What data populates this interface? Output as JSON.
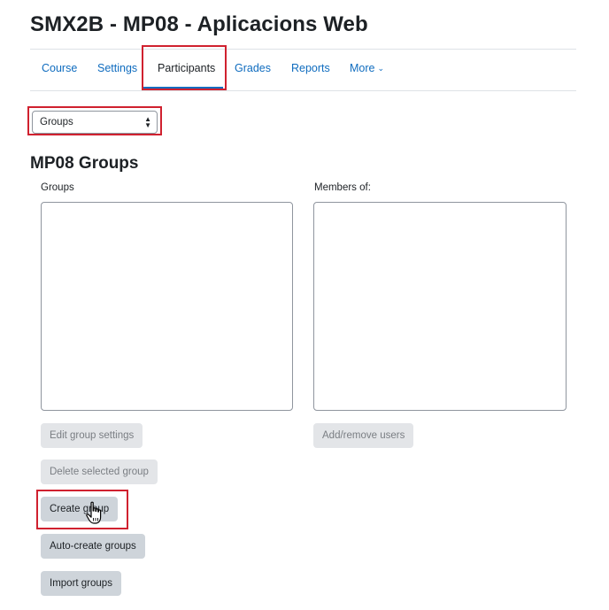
{
  "course": {
    "title": "SMX2B - MP08 - Aplicacions Web"
  },
  "nav": {
    "items": [
      "Course",
      "Settings",
      "Participants",
      "Grades",
      "Reports",
      "More"
    ],
    "active": "Participants",
    "more_icon": "chevron-down-icon"
  },
  "page_select": {
    "value": "Groups",
    "icon": "sort-arrows-icon"
  },
  "groups_page": {
    "title": "MP08 Groups",
    "groups_label": "Groups",
    "members_label": "Members of:",
    "groups_list": [],
    "members_list": []
  },
  "buttons": {
    "edit_group_settings": "Edit group settings",
    "delete_selected_group": "Delete selected group",
    "create_group": "Create group",
    "auto_create_groups": "Auto-create groups",
    "import_groups": "Import groups",
    "add_remove_users": "Add/remove users"
  },
  "highlight_color": "#d0212f",
  "link_color": "#0f6cbf",
  "cursor_icon": "hand-pointer-icon"
}
